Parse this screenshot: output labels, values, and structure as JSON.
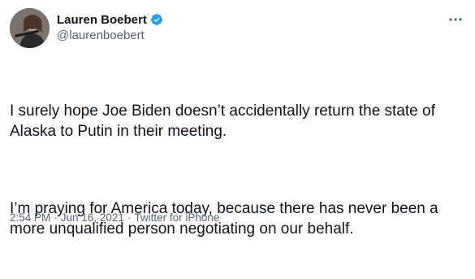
{
  "tweet": {
    "author": {
      "display_name": "Lauren Boebert",
      "handle": "@laurenboebert",
      "verified": true
    },
    "more_icon": "more-horizontal-icon",
    "text": {
      "paragraph_1": "I surely hope Joe Biden doesn’t accidentally return the state of Alaska to Putin in their meeting.",
      "paragraph_2": "I’m praying for America today, because there has never been a more unqualified person negotiating on our behalf."
    },
    "meta": {
      "time": "2:54 PM",
      "date": "Jun 16, 2021",
      "source": "Twitter for iPhone",
      "separator": "·"
    }
  },
  "colors": {
    "text_primary": "#0f1419",
    "text_secondary": "#536471",
    "verified_blue": "#1d9bf0",
    "background": "#ffffff"
  }
}
